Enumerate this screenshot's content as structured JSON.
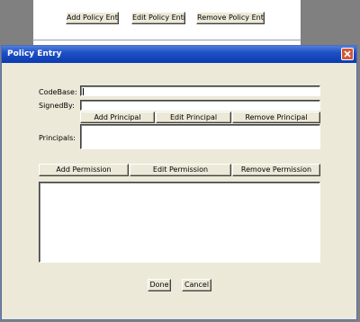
{
  "background_window": {
    "buttons": {
      "add_policy_entry": "Add Policy Entry",
      "edit_policy_entry": "Edit Policy Entry",
      "remove_policy_entry": "Remove Policy Entry"
    }
  },
  "dialog": {
    "title": "Policy Entry",
    "fields": {
      "codebase_label": "CodeBase:",
      "codebase_value": "",
      "signedby_label": "SignedBy:",
      "signedby_value": ""
    },
    "principals": {
      "label": "Principals:",
      "add_label": "Add Principal",
      "edit_label": "Edit Principal",
      "remove_label": "Remove Principal",
      "items": []
    },
    "permissions": {
      "add_label": "Add Permission",
      "edit_label": "Edit Permission",
      "remove_label": "Remove Permission",
      "items": []
    },
    "footer": {
      "done_label": "Done",
      "cancel_label": "Cancel"
    }
  },
  "colors": {
    "dialog_face": "#ece9d8",
    "titlebar_blue": "#0a3cb0",
    "close_red": "#d0573a"
  }
}
